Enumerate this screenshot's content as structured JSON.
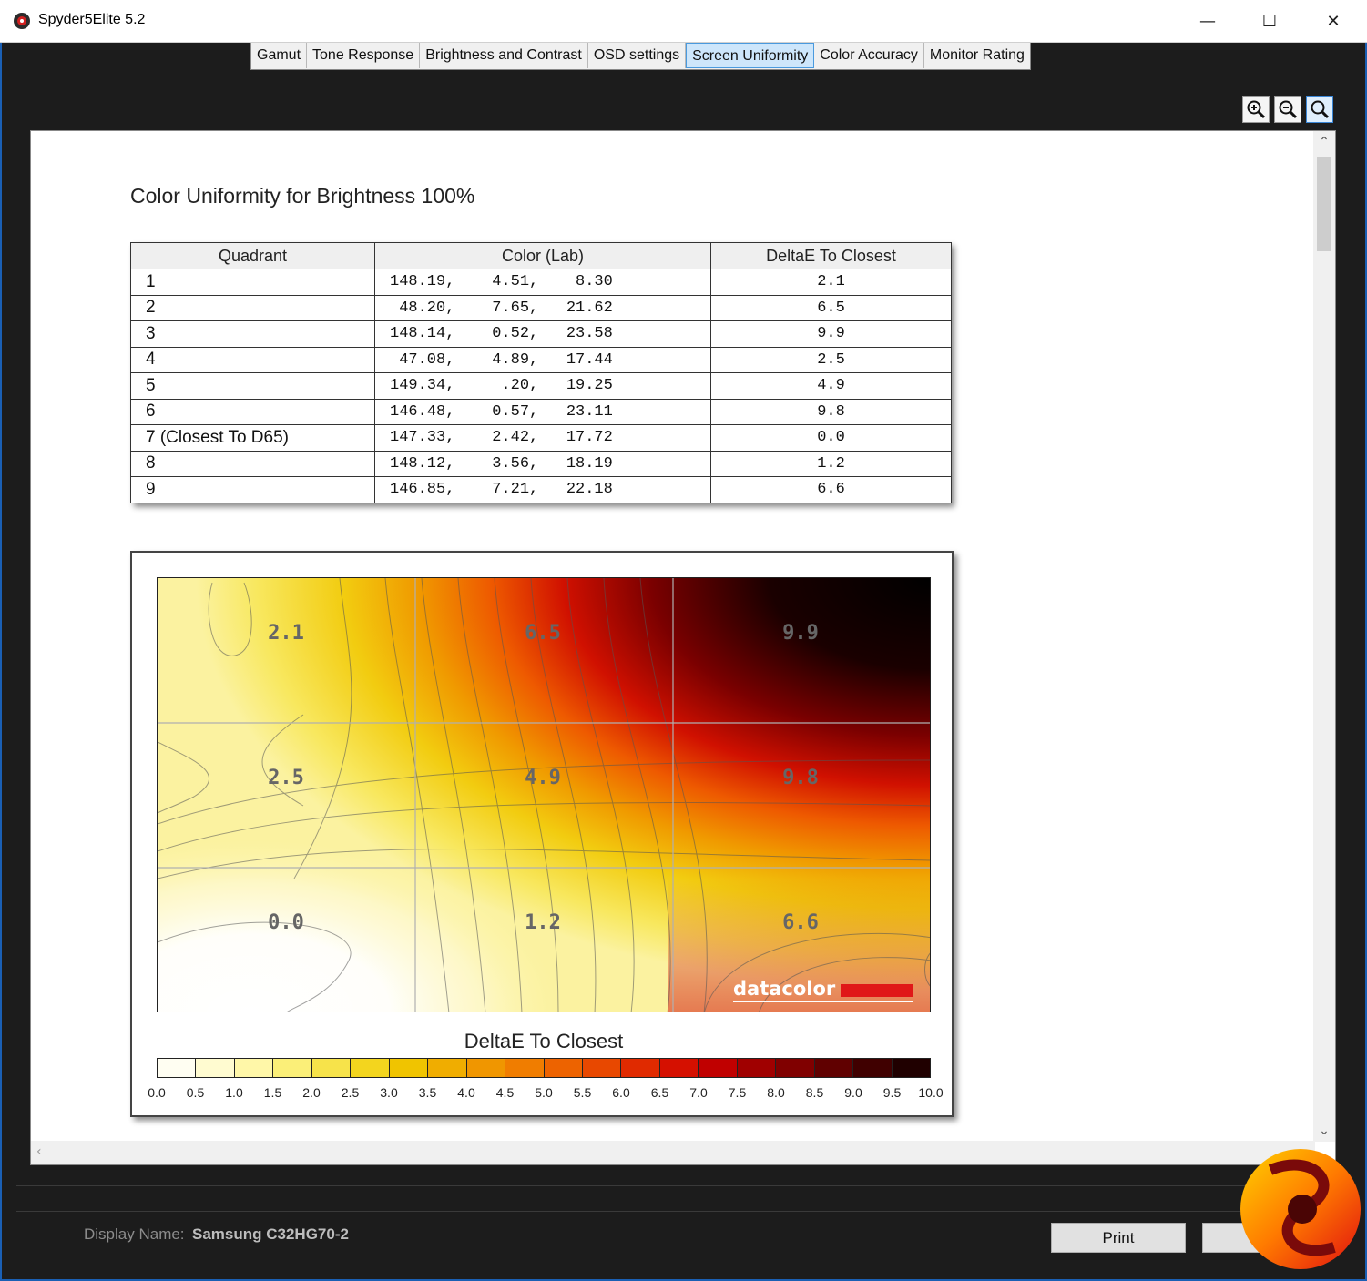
{
  "window": {
    "title": "Spyder5Elite 5.2",
    "minimize": "—",
    "maximize": "☐",
    "close": "✕"
  },
  "tabs": [
    {
      "label": "Gamut"
    },
    {
      "label": "Tone Response"
    },
    {
      "label": "Brightness and Contrast"
    },
    {
      "label": "OSD settings"
    },
    {
      "label": "Screen Uniformity",
      "active": true
    },
    {
      "label": "Color Accuracy"
    },
    {
      "label": "Monitor Rating"
    }
  ],
  "zoom": {
    "zoom_in": "zoom-in-icon",
    "zoom_out": "zoom-out-icon",
    "zoom_fit": "zoom-fit-icon"
  },
  "report": {
    "title": "Color Uniformity for Brightness 100%",
    "columns": [
      "Quadrant",
      "Color (Lab)",
      "DeltaE To Closest"
    ],
    "rows": [
      {
        "quadrant": "1",
        "lab": "148.19,    4.51,    8.30",
        "delta": "2.1"
      },
      {
        "quadrant": "2",
        "lab": " 48.20,    7.65,   21.62",
        "delta": "6.5"
      },
      {
        "quadrant": "3",
        "lab": "148.14,    0.52,   23.58",
        "delta": "9.9"
      },
      {
        "quadrant": "4",
        "lab": " 47.08,    4.89,   17.44",
        "delta": "2.5"
      },
      {
        "quadrant": "5",
        "lab": "149.34,     .20,   19.25",
        "delta": "4.9"
      },
      {
        "quadrant": "6",
        "lab": "146.48,    0.57,   23.11",
        "delta": "9.8"
      },
      {
        "quadrant": "7 (Closest To D65)",
        "lab": "147.33,    2.42,   17.72",
        "delta": "0.0"
      },
      {
        "quadrant": "8",
        "lab": "148.12,    3.56,   18.19",
        "delta": "1.2"
      },
      {
        "quadrant": "9",
        "lab": "146.85,    7.21,   22.18",
        "delta": "6.6"
      }
    ]
  },
  "heatmap": {
    "cells": [
      "2.1",
      "6.5",
      "9.9",
      "2.5",
      "4.9",
      "9.8",
      "0.0",
      "1.2",
      "6.6"
    ],
    "watermark": "datacolor",
    "legend_title": "DeltaE To Closest",
    "legend_ticks": [
      "0.0",
      "0.5",
      "1.0",
      "1.5",
      "2.0",
      "2.5",
      "3.0",
      "3.5",
      "4.0",
      "4.5",
      "5.0",
      "5.5",
      "6.0",
      "6.5",
      "7.0",
      "7.5",
      "8.0",
      "8.5",
      "9.0",
      "9.5",
      "10.0"
    ],
    "legend_colors": [
      "#fffef2",
      "#fffbd0",
      "#fff7a8",
      "#fbef78",
      "#f7e34a",
      "#f3d51e",
      "#f0c400",
      "#f0ad00",
      "#f09600",
      "#f07d00",
      "#ed6300",
      "#e84800",
      "#e02a00",
      "#d51000",
      "#c00000",
      "#a00000",
      "#800000",
      "#600000",
      "#400000",
      "#200000"
    ]
  },
  "footer": {
    "display_label": "Display Name:",
    "display_value": "Samsung C32HG70-2",
    "print_button": "Print",
    "next_button": ""
  }
}
